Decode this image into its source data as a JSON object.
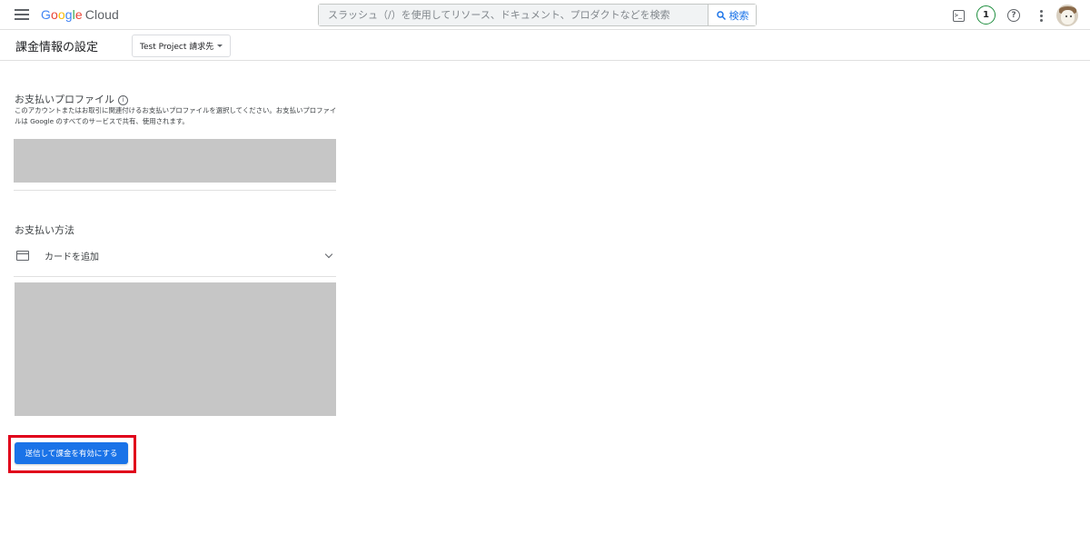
{
  "app": {
    "logo_letters": [
      "G",
      "o",
      "o",
      "g",
      "l",
      "e"
    ],
    "logo_suffix": "Cloud"
  },
  "search": {
    "placeholder": "スラッシュ（/）を使用してリソース、ドキュメント、プロダクトなどを検索",
    "button_label": "検索"
  },
  "topbar": {
    "notification_count": "1",
    "icons": [
      "menu-icon",
      "terminal-icon",
      "help-icon",
      "more-vert-icon",
      "avatar"
    ]
  },
  "header": {
    "page_title": "課金情報の設定",
    "project_label": "Test Project 請求先"
  },
  "payment_profile": {
    "title": "お支払いプロファイル",
    "description": "このアカウントまたはお取引に関連付けるお支払いプロファイルを選択してください。お支払いプロファイルは Google のすべてのサービスで共有、使用されます。"
  },
  "payment_method": {
    "title": "お支払い方法",
    "add_card_label": "カードを追加"
  },
  "actions": {
    "submit_label": "送信して課金を有効にする"
  },
  "colors": {
    "primary": "#1a73e8",
    "highlight": "#e0001b",
    "redacted": "#c6c6c6",
    "notification_ring": "#1e8e3e"
  }
}
